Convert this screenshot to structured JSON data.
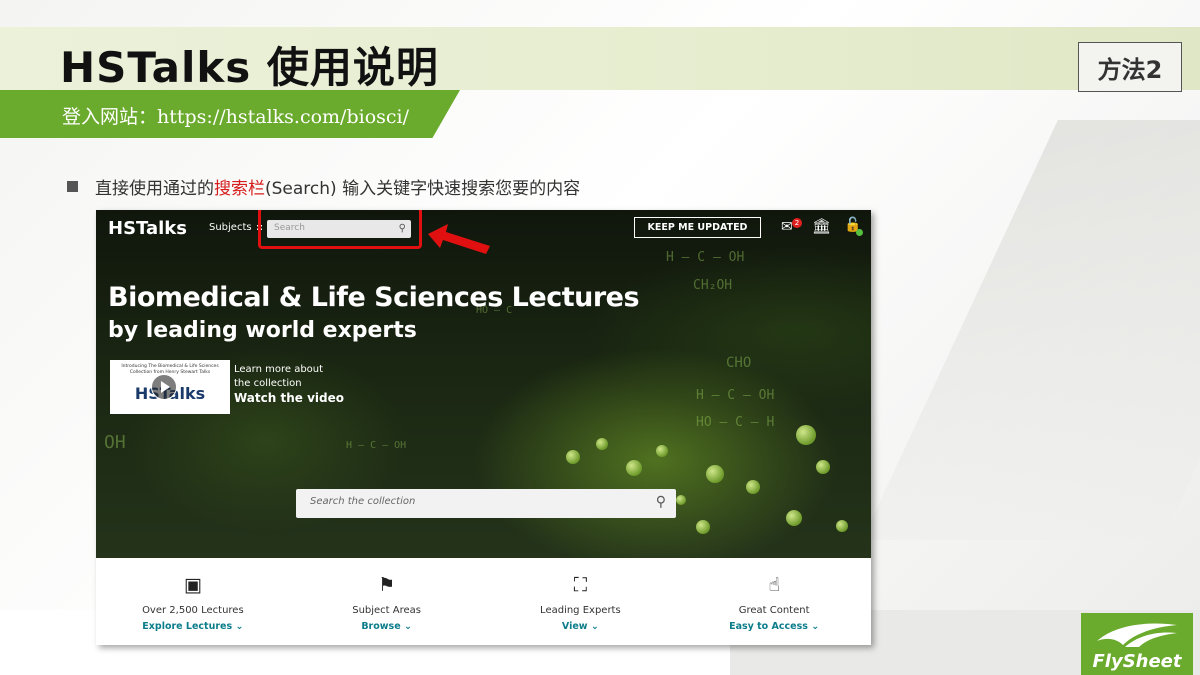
{
  "slide": {
    "title": "HSTalks 使用说明",
    "method_badge": "方法2",
    "subtitle": "登入网站：https://hstalks.com/biosci/",
    "bullet": {
      "before": "直接使用通过的",
      "highlight": "搜索栏",
      "after": " (Search) 输入关键字快速搜索您要的内容"
    }
  },
  "screenshot": {
    "nav": {
      "logo": "HSTalks",
      "subjects": "Subjects",
      "search_placeholder": "Search",
      "keep_updated": "KEEP ME UPDATED",
      "mail_badge": "2"
    },
    "hero": {
      "title": "Biomedical & Life Sciences Lectures",
      "subtitle": "by leading world experts",
      "video": {
        "thumb_small": "Introducing The Biomedical & Life Sciences Collection from Henry Stewart Talks",
        "thumb_logo": "HSTalks",
        "learn_line1": "Learn more about",
        "learn_line2": "the collection",
        "watch": "Watch the video"
      },
      "search_placeholder": "Search the collection"
    },
    "features": [
      {
        "icon": "video-icon",
        "title": "Over 2,500 Lectures",
        "link": "Explore Lectures"
      },
      {
        "icon": "flag-icon",
        "title": "Subject Areas",
        "link": "Browse"
      },
      {
        "icon": "lectern-icon",
        "title": "Leading Experts",
        "link": "View"
      },
      {
        "icon": "pointer-hand-icon",
        "title": "Great Content",
        "link": "Easy to Access"
      }
    ]
  },
  "footer": {
    "brand": "FlySheet"
  },
  "colors": {
    "accent_green": "#6aaa2c",
    "highlight_red": "#e01010",
    "link_teal": "#0b7d8a"
  }
}
